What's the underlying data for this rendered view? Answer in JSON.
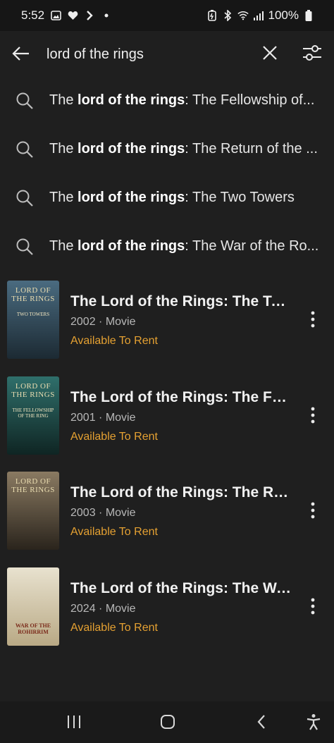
{
  "status": {
    "time": "5:52",
    "battery": "100%"
  },
  "search": {
    "query": "lord of the rings",
    "placeholder": ""
  },
  "suggestions": [
    {
      "prefix": "The ",
      "match": "lord of the rings",
      "suffix": ": The Fellowship of..."
    },
    {
      "prefix": "The ",
      "match": "lord of the rings",
      "suffix": ": The Return of the ..."
    },
    {
      "prefix": "The ",
      "match": "lord of the rings",
      "suffix": ": The Two Towers"
    },
    {
      "prefix": "The ",
      "match": "lord of the rings",
      "suffix": ": The War of the Ro..."
    }
  ],
  "results": [
    {
      "title": "The Lord of the Rings: The Tw...",
      "meta": "2002 · Movie",
      "availability": "Available To Rent",
      "poster_title": "Lord of the Rings",
      "poster_sub": "Two Towers",
      "poster_colors": [
        "#4a6b80",
        "#1c2a33"
      ]
    },
    {
      "title": "The Lord of the Rings: The Fell...",
      "meta": "2001 · Movie",
      "availability": "Available To Rent",
      "poster_title": "Lord of the Rings",
      "poster_sub": "The Fellowship of the Ring",
      "poster_colors": [
        "#2f6f6b",
        "#0f2523"
      ]
    },
    {
      "title": "The Lord of the Rings: The Ret...",
      "meta": "2003 · Movie",
      "availability": "Available To Rent",
      "poster_title": "Lord of the Rings",
      "poster_sub": "",
      "poster_colors": [
        "#8a7a62",
        "#2a241c"
      ]
    },
    {
      "title": "The Lord of the Rings: The Wa...",
      "meta": "2024 · Movie",
      "availability": "Available To Rent",
      "poster_title": "",
      "poster_sub": "War of the Rohirrim",
      "poster_colors": [
        "#e8e2cf",
        "#b9a985"
      ]
    }
  ],
  "colors": {
    "accent": "#e5a132",
    "background": "#1f1f1f"
  }
}
